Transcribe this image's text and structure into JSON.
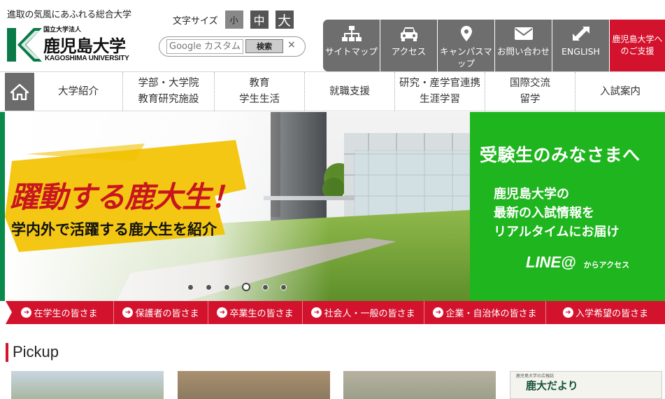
{
  "header": {
    "tagline": "進取の気風にあふれる総合大学",
    "logo": {
      "small": "国立大学法人",
      "name": "鹿児島大学",
      "english": "KAGOSHIMA UNIVERSITY"
    },
    "font_size": {
      "label": "文字サイズ",
      "small": "小",
      "medium": "中",
      "large": "大"
    },
    "search": {
      "placeholder": "Google カスタム",
      "button": "検索",
      "clear": "×"
    },
    "quick_links": [
      {
        "label": "サイトマップ",
        "icon": "sitemap-icon"
      },
      {
        "label": "アクセス",
        "icon": "car-icon"
      },
      {
        "label": "キャンパスマップ",
        "icon": "map-pin-icon"
      },
      {
        "label": "お問い合わせ",
        "icon": "envelope-icon"
      },
      {
        "label": "ENGLISH",
        "icon": "expand-arrows-icon"
      }
    ],
    "support": "鹿児島大学へのご支援",
    "colors": {
      "gray": "#6e6e6e",
      "red": "#d3132d",
      "green": "#1fb51f"
    }
  },
  "nav": {
    "home_icon": "home-icon",
    "items": [
      "大学紹介",
      "学部・大学院\n教育研究施設",
      "教育\n学生生活",
      "就職支援",
      "研究・産学官連携\n生涯学習",
      "国際交流\n留学",
      "入試案内"
    ]
  },
  "hero": {
    "title": "躍動する鹿大生！",
    "subtitle": "学内外で活躍する鹿大生を紹介",
    "slide_count": 6,
    "active_slide": 4
  },
  "line_banner": {
    "title": "受験生のみなさまへ",
    "body": "鹿児島大学の\n最新の入試情報を\nリアルタイムにお届け",
    "brand": "LINE@",
    "access": "からアクセス"
  },
  "audience": [
    "在学生の皆さま",
    "保護者の皆さま",
    "卒業生の皆さま",
    "社会人・一般の皆さま",
    "企業・自治体の皆さま",
    "入学希望の皆さま"
  ],
  "pickup": {
    "title": "Pickup",
    "card4_label": "鹿大だより",
    "card4_small": "鹿児島大学の広報誌"
  }
}
